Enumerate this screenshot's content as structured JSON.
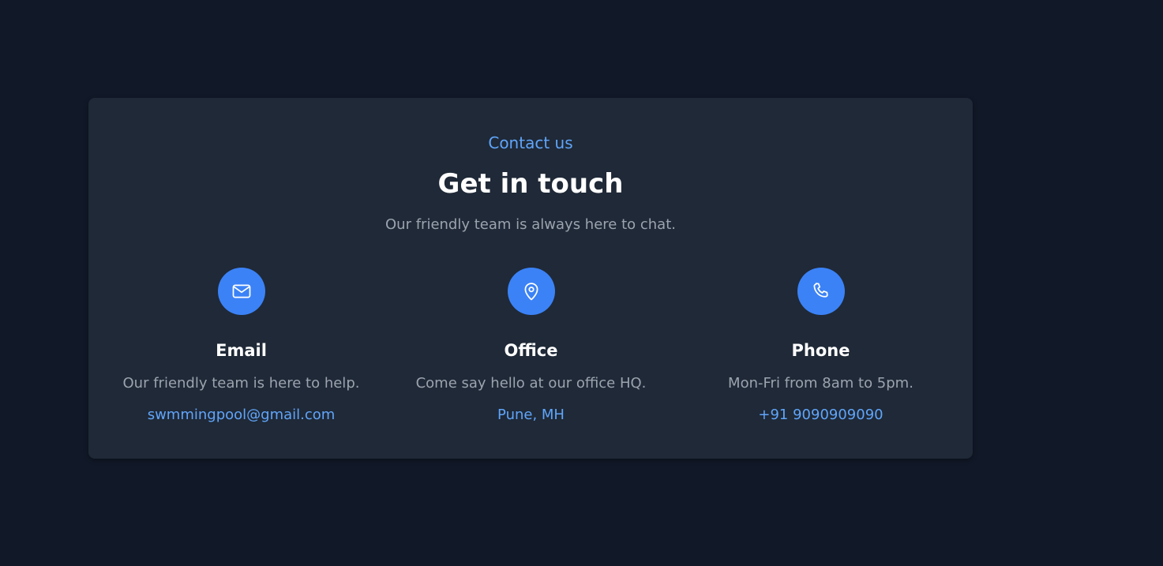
{
  "colors": {
    "page_background": "#111827",
    "card_background": "#1f2937",
    "accent": "#3b82f6",
    "accent_text": "#60a5fa",
    "heading": "#ffffff",
    "muted_text": "#9ca3af"
  },
  "header": {
    "eyebrow": "Contact us",
    "title": "Get in touch",
    "subtitle": "Our friendly team is always here to chat."
  },
  "contacts": [
    {
      "icon": "mail-icon",
      "title": "Email",
      "description": "Our friendly team is here to help.",
      "link": "swmmingpool@gmail.com"
    },
    {
      "icon": "map-pin-icon",
      "title": "Office",
      "description": "Come say hello at our office HQ.",
      "link": "Pune, MH"
    },
    {
      "icon": "phone-icon",
      "title": "Phone",
      "description": "Mon-Fri from 8am to 5pm.",
      "link": "+91 9090909090"
    }
  ]
}
